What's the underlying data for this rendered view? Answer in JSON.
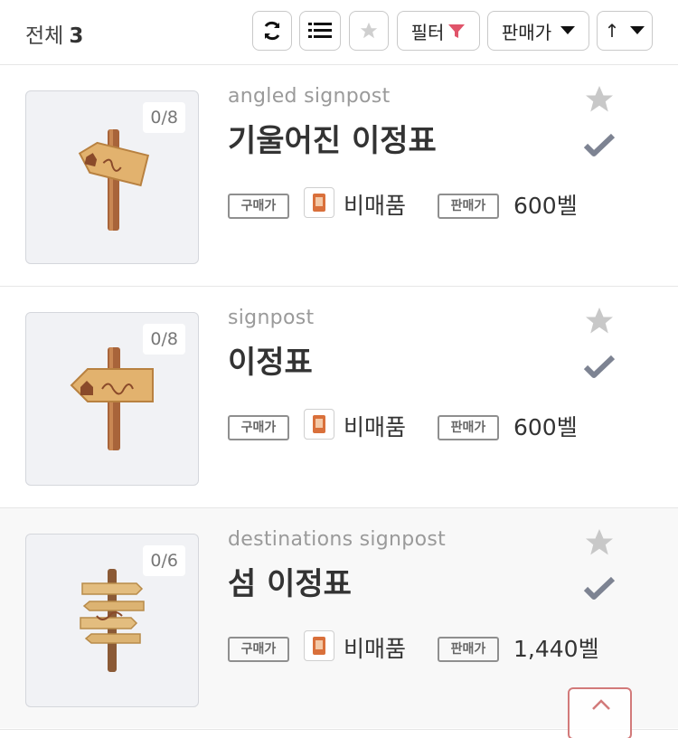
{
  "header": {
    "total_label": "전체",
    "total_count": "3",
    "filter_label": "필터",
    "sort_label": "판매가",
    "order_label": "↑"
  },
  "items": [
    {
      "name_en": "angled signpost",
      "name_ko": "기울어진 이정표",
      "count": "0/8",
      "buy_tag": "구매가",
      "buy_value": "비매품",
      "sell_tag": "판매가",
      "sell_value": "600벨"
    },
    {
      "name_en": "signpost",
      "name_ko": "이정표",
      "count": "0/8",
      "buy_tag": "구매가",
      "buy_value": "비매품",
      "sell_tag": "판매가",
      "sell_value": "600벨"
    },
    {
      "name_en": "destinations signpost",
      "name_ko": "섬 이정표",
      "count": "0/6",
      "buy_tag": "구매가",
      "buy_value": "비매품",
      "sell_tag": "판매가",
      "sell_value": "1,440벨"
    }
  ],
  "icons": {
    "refresh": "refresh-icon",
    "list": "list-icon",
    "star": "star-icon",
    "filter": "filter-icon",
    "dropdown": "caret-down-icon",
    "check": "check-icon",
    "scroll_top": "chevron-up-icon",
    "ticket": "ticket-icon"
  },
  "colors": {
    "filter_accent": "#e0546a",
    "star": "#c8c8c8",
    "check": "#7d8392",
    "scroll_border": "#d27a7a"
  }
}
